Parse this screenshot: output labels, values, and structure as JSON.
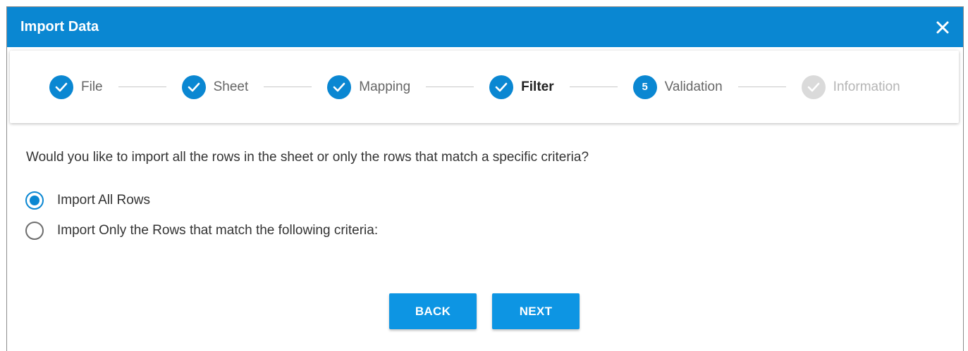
{
  "dialog": {
    "title": "Import Data",
    "close_icon": "close-icon",
    "accent_color": "#0a87d2"
  },
  "stepper": {
    "steps": [
      {
        "label": "File",
        "state": "completed",
        "icon": "check-icon"
      },
      {
        "label": "Sheet",
        "state": "completed",
        "icon": "check-icon"
      },
      {
        "label": "Mapping",
        "state": "completed",
        "icon": "check-icon"
      },
      {
        "label": "Filter",
        "state": "active-completed",
        "icon": "check-icon"
      },
      {
        "label": "Validation",
        "state": "current",
        "number": "5"
      },
      {
        "label": "Information",
        "state": "pending",
        "icon": "check-icon"
      }
    ]
  },
  "filter": {
    "question": "Would you like to import all the rows in the sheet or only the rows that match a specific criteria?",
    "options": [
      {
        "label": "Import All Rows",
        "selected": true
      },
      {
        "label": "Import Only the Rows that match the following criteria:",
        "selected": false
      }
    ]
  },
  "actions": {
    "back_label": "BACK",
    "next_label": "NEXT"
  }
}
